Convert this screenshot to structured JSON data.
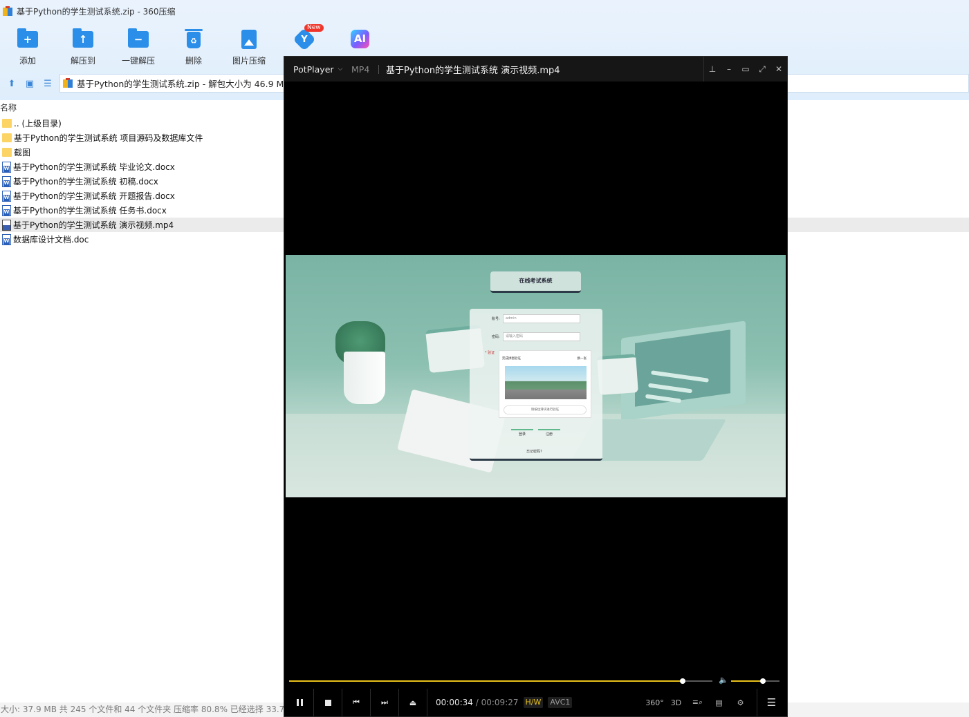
{
  "zip_window": {
    "title": "基于Python的学生测试系统.zip - 360压缩",
    "toolbar": [
      {
        "label": "添加",
        "icon": "add-folder-icon"
      },
      {
        "label": "解压到",
        "icon": "extract-to-icon"
      },
      {
        "label": "一键解压",
        "icon": "one-click-extract-icon"
      },
      {
        "label": "删除",
        "icon": "delete-icon"
      },
      {
        "label": "图片压缩",
        "icon": "image-compress-icon"
      },
      {
        "label": "",
        "icon": "cloud-tool-icon",
        "badge": "New"
      },
      {
        "label": "",
        "icon": "ai-icon",
        "glyph": "AI"
      }
    ],
    "path": "基于Python的学生测试系统.zip - 解包大小为 46.9 MB",
    "column_header": "名称",
    "files": [
      {
        "name": ".. (上级目录)",
        "type": "folder"
      },
      {
        "name": "基于Python的学生测试系统 项目源码及数据库文件",
        "type": "folder"
      },
      {
        "name": "截图",
        "type": "folder"
      },
      {
        "name": "基于Python的学生测试系统 毕业论文.docx",
        "type": "doc"
      },
      {
        "name": "基于Python的学生测试系统 初稿.docx",
        "type": "doc"
      },
      {
        "name": "基于Python的学生测试系统 开题报告.docx",
        "type": "doc"
      },
      {
        "name": "基于Python的学生测试系统 任务书.docx",
        "type": "doc"
      },
      {
        "name": "基于Python的学生测试系统 演示视频.mp4",
        "type": "mp4",
        "selected": true
      },
      {
        "name": "数据库设计文档.doc",
        "type": "doc"
      }
    ],
    "status": "大小: 37.9 MB 共 245 个文件和 44 个文件夹 压缩率 80.8% 已经选择 33.7 M"
  },
  "player": {
    "brand": "PotPlayer",
    "format": "MP4",
    "file_title": "基于Python的学生测试系统 演示视频.mp4",
    "current_time": "00:00:34",
    "duration": "00:09:27",
    "separator": "/",
    "hw_tag": "H/W",
    "codec_tag": "AVC1",
    "seek_fraction": 0.929,
    "volume_fraction": 0.66,
    "right_controls": [
      "360°",
      "3D"
    ],
    "video": {
      "app_title": "在线考试系统",
      "account_label": "账号:",
      "account_value": "admin",
      "password_label": "密码:",
      "password_placeholder": "请输入密码",
      "verify_label": "* 验证",
      "captcha_hint": "完成拼图验证",
      "captcha_refresh": "换一张",
      "slider_hint": "请按住滑块进行验证",
      "login_button": "登录",
      "register_button": "注册",
      "forgot": "忘记密码?"
    }
  },
  "colors": {
    "accent_blue": "#2b8ee8",
    "player_progress": "#e9c21c",
    "selected_row": "#ebebeb"
  }
}
